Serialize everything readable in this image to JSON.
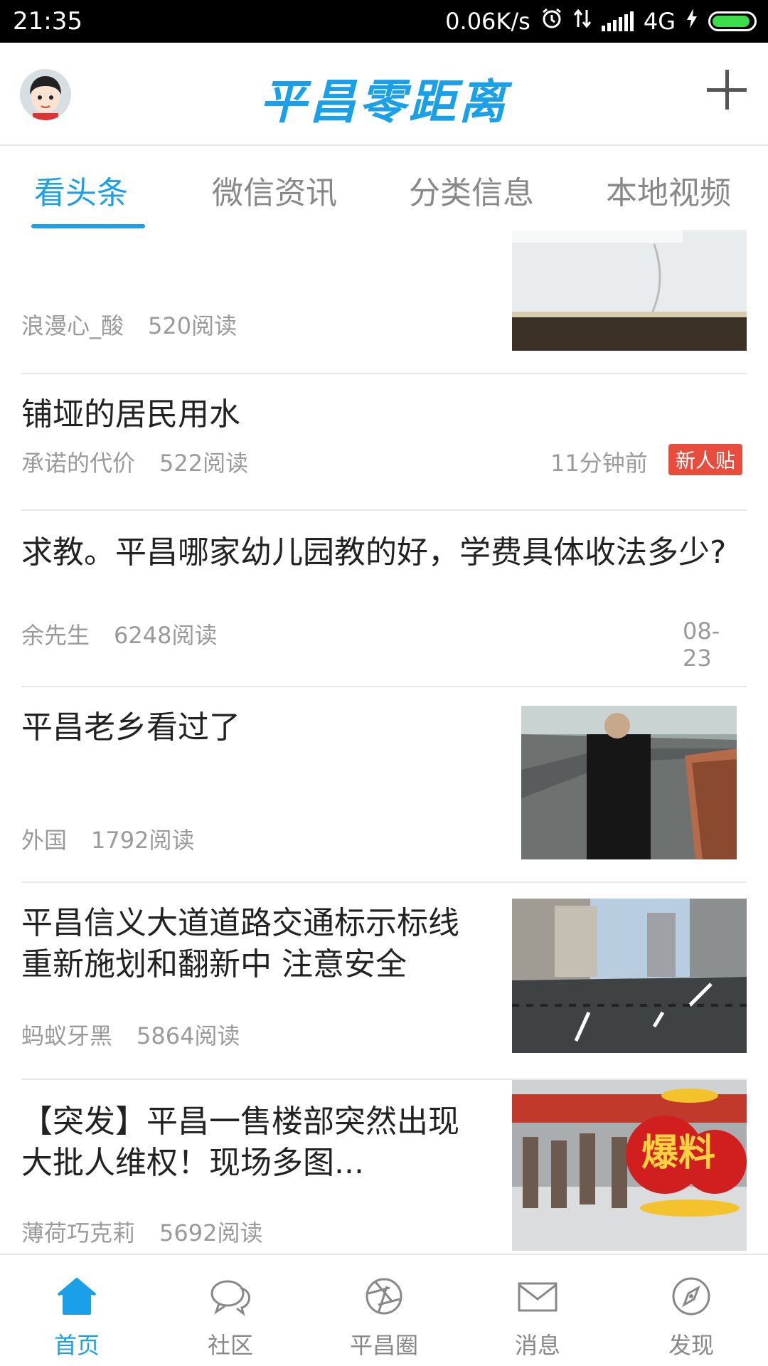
{
  "status_bar": {
    "time": "21:35",
    "net_speed": "0.06K/s",
    "network": "4G",
    "icons": [
      "alarm-icon",
      "data-transfer-icon",
      "signal-icon",
      "lightning-icon",
      "battery-icon"
    ]
  },
  "header": {
    "logo_text": "平昌零距离",
    "brand_color": "#1aa0e8",
    "avatar_icon": "avatar-icon",
    "add_icon": "plus-icon"
  },
  "tabs": [
    {
      "label": "看头条",
      "active": true
    },
    {
      "label": "微信资讯",
      "active": false
    },
    {
      "label": "分类信息",
      "active": false
    },
    {
      "label": "本地视频",
      "active": false
    }
  ],
  "feed": [
    {
      "title": "",
      "author": "浪漫心_酸",
      "reads": "520阅读",
      "thumb": "air-conditioner-photo"
    },
    {
      "title": "铺垭的居民用水",
      "author": "承诺的代价",
      "reads": "522阅读",
      "time": "11分钟前",
      "badge": "新人贴"
    },
    {
      "title": "求教。平昌哪家幼儿园教的好，学费具体收法多少?",
      "author": "余先生",
      "reads": "6248阅读",
      "time": "08-23"
    },
    {
      "title": "平昌老乡看过了",
      "author": "外国",
      "reads": "1792阅读",
      "thumb": "man-on-bridge-photo"
    },
    {
      "title": "平昌信义大道道路交通标示标线重新施划和翻新中 注意安全",
      "author": "蚂蚁牙黑",
      "reads": "5864阅读",
      "thumb": "city-road-photo"
    },
    {
      "title": "【突发】平昌一售楼部突然出现大批人维权！现场多图...",
      "author": "薄荷巧克莉",
      "reads": "5692阅读",
      "thumb": "crowd-protest-photo",
      "thumb_overlay": "爆料"
    }
  ],
  "bottom_nav": [
    {
      "label": "首页",
      "icon": "home-icon",
      "active": true
    },
    {
      "label": "社区",
      "icon": "chat-bubble-icon",
      "active": false
    },
    {
      "label": "平昌圈",
      "icon": "aperture-icon",
      "active": false
    },
    {
      "label": "消息",
      "icon": "envelope-icon",
      "active": false
    },
    {
      "label": "发现",
      "icon": "compass-icon",
      "active": false
    }
  ]
}
